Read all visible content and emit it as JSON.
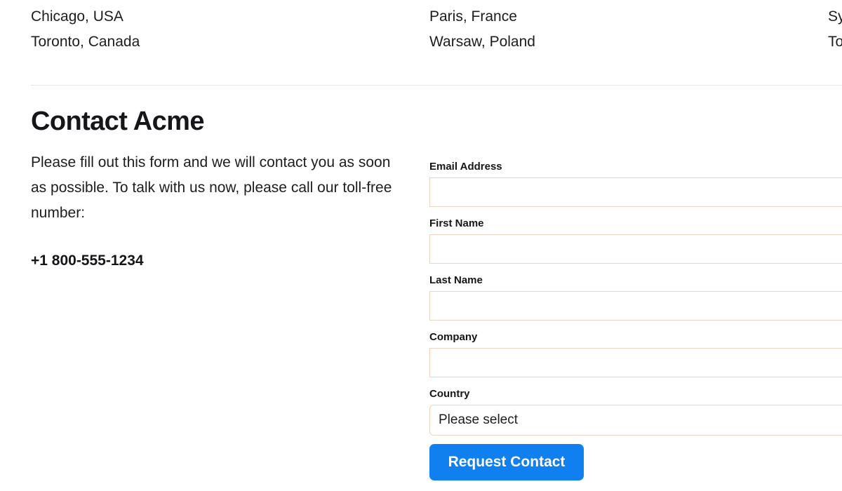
{
  "locations": {
    "columns": [
      {
        "lines": [
          "Chicago, USA",
          "Toronto, Canada"
        ]
      },
      {
        "lines": [
          "Paris, France",
          "Warsaw, Poland"
        ]
      },
      {
        "lines": [
          "Sy",
          "To"
        ]
      }
    ]
  },
  "contact": {
    "title": "Contact Acme",
    "lede": "Please fill out this form and we will contact you as soon as possible. To talk with us now, please call our toll-free number:",
    "phone": "+1 800-555-1234"
  },
  "form": {
    "fields": [
      {
        "label": "Email Address",
        "value": "",
        "placeholder": ""
      },
      {
        "label": "First Name",
        "value": "",
        "placeholder": ""
      },
      {
        "label": "Last Name",
        "value": "",
        "placeholder": ""
      },
      {
        "label": "Company",
        "value": "",
        "placeholder": ""
      }
    ],
    "country": {
      "label": "Country",
      "selected": "Please select"
    },
    "submit_label": "Request Contact",
    "accent_color": "#1080f0",
    "field_border_color": "#ecd3c4"
  }
}
